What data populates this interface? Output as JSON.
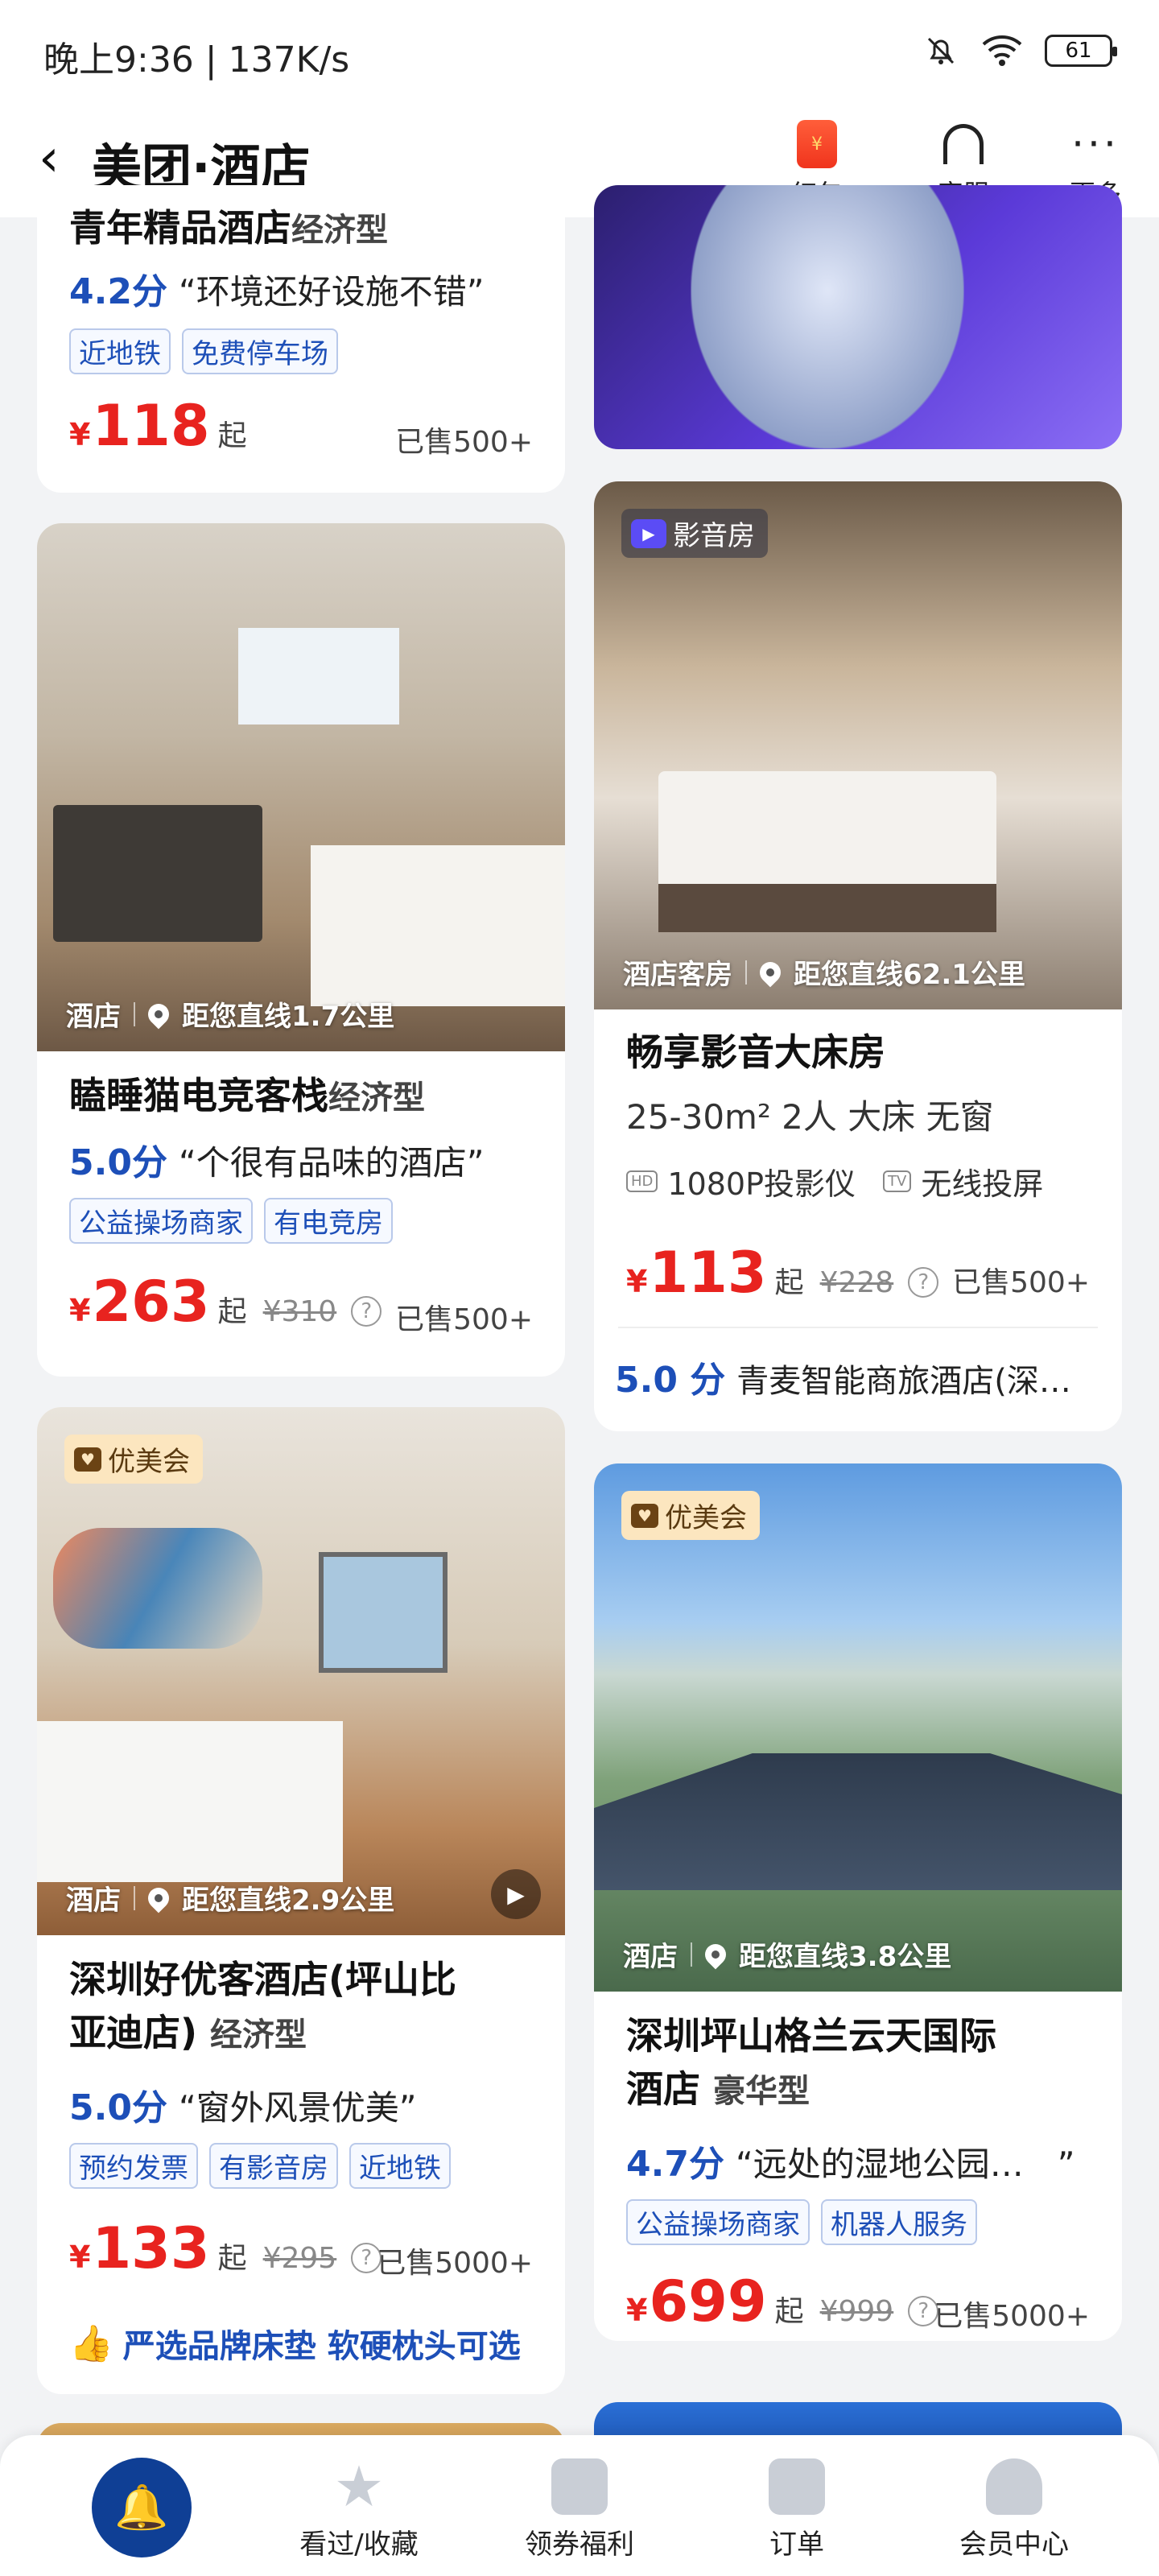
{
  "status_bar": {
    "time": "晚上9:36 | 137K/s",
    "battery": "61"
  },
  "header": {
    "title": "美团·酒店",
    "buttons": [
      {
        "label": "红包",
        "icon": "red-packet-icon"
      },
      {
        "label": "客服",
        "icon": "headset-icon"
      },
      {
        "label": "更多",
        "icon": "more-dots-icon"
      }
    ]
  },
  "cards": [
    {
      "name": "青年精品酒店",
      "type": "经济型",
      "score": "4.2分",
      "review": "“环境还好设施不错”",
      "tags": [
        "近地铁",
        "免费停车场"
      ],
      "price": "118",
      "price_suffix": "起",
      "sold": "已售500+"
    },
    {
      "badge": "影音房",
      "category": "酒店客房",
      "distance": "距您直线62.1公里",
      "room_name": "畅享影音大床房",
      "room_info": "25-30m² 2人 大床 无窗",
      "facilities": [
        {
          "icon": "hd-icon",
          "label": "1080P投影仪"
        },
        {
          "icon": "tv-cast-icon",
          "label": "无线投屏"
        }
      ],
      "price": "113",
      "price_suffix": "起",
      "orig_price": "¥228",
      "sold": "已售500+",
      "hotel_score": "5.0 分",
      "hotel_name": "青麦智能商旅酒店(深…"
    },
    {
      "category": "酒店",
      "distance": "距您直线1.7公里",
      "name": "瞌睡猫电竞客栈",
      "type": "经济型",
      "score": "5.0分",
      "review": "“个很有品味的酒店”",
      "tags": [
        "公益操场商家",
        "有电竞房"
      ],
      "price": "263",
      "price_suffix": "起",
      "orig_price": "¥310",
      "sold": "已售500+"
    },
    {
      "badge": "优美会",
      "category": "酒店",
      "distance": "距您直线2.9公里",
      "name_line1": "深圳好优客酒店(坪山比",
      "name_line2": "亚迪店)",
      "type": "经济型",
      "score": "5.0分",
      "review": "“窗外风景优美”",
      "tags": [
        "预约发票",
        "有影音房",
        "近地铁"
      ],
      "price": "133",
      "price_suffix": "起",
      "orig_price": "¥295",
      "sold": "已售5000+",
      "feature": "严选品牌床垫 软硬枕头可选"
    },
    {
      "badge": "优美会",
      "category": "酒店",
      "distance": "距您直线3.8公里",
      "name_line1": "深圳坪山格兰云天国际",
      "name_line2": "酒店",
      "type": "豪华型",
      "score": "4.7分",
      "review": "“远处的湿地公园…　”",
      "tags": [
        "公益操场商家",
        "机器人服务"
      ],
      "price": "699",
      "price_suffix": "起",
      "orig_price": "¥999",
      "sold": "已售5000+"
    }
  ],
  "bottom_nav": [
    {
      "label": "",
      "icon": "home-rocket-icon"
    },
    {
      "label": "看过/收藏",
      "icon": "star-icon"
    },
    {
      "label": "领券福利",
      "icon": "coupon-icon"
    },
    {
      "label": "订单",
      "icon": "order-icon"
    },
    {
      "label": "会员中心",
      "icon": "member-icon"
    }
  ],
  "colors": {
    "accent_blue": "#1d4fb8",
    "price_red": "#e8231f",
    "nav_home": "#0f3f95"
  }
}
